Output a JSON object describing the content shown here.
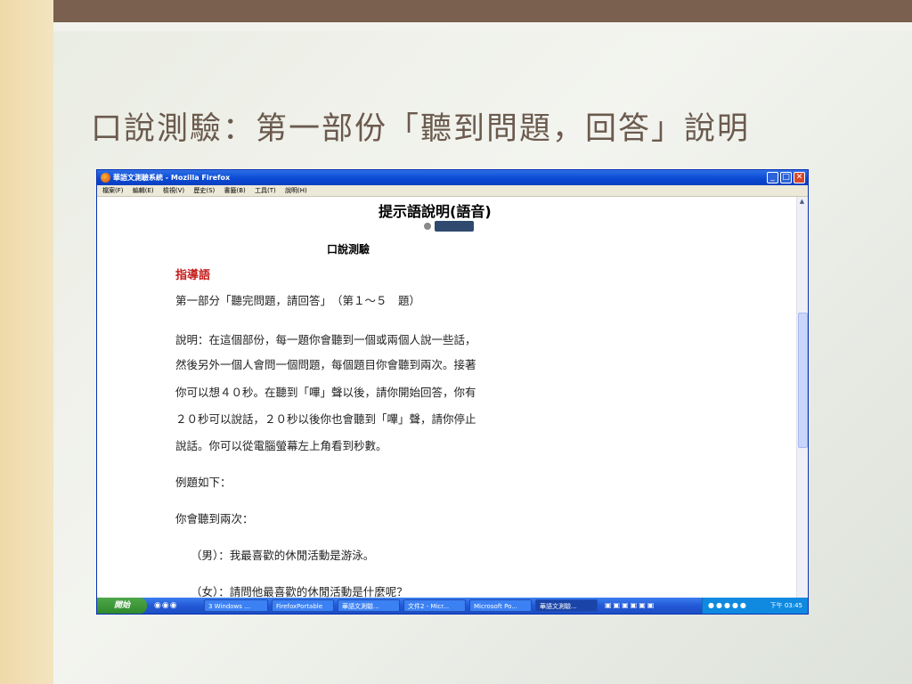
{
  "slide": {
    "title": "口說測驗：第一部份「聽到問題，回答」說明"
  },
  "window": {
    "title": "華語文測驗系統 - Mozilla Firefox",
    "menu": [
      "檔案(F)",
      "編輯(E)",
      "檢視(V)",
      "歷史(S)",
      "書籤(B)",
      "工具(T)",
      "說明(H)"
    ],
    "buttons": {
      "minimize": "_",
      "maximize": "□",
      "close": "✕"
    }
  },
  "content": {
    "heading": "提示語說明(語音)",
    "subheading": "口說測驗",
    "guide_label": "指導語",
    "part_line": "第一部分「聽完問題，請回答」　（第１～５　題）",
    "description": [
      "說明：在這個部份，每一題你會聽到一個或兩個人說一些話，",
      "然後另外一個人會問一個問題，每個題目你會聽到兩次。接著",
      "你可以想４０秒。在聽到「嗶」聲以後，請你開始回答，你有",
      "２０秒可以說話，２０秒以後你也會聽到「嗶」聲，請你停止",
      "說話。你可以從電腦螢幕左上角看到秒數。"
    ],
    "example_label": "例題如下：",
    "hear_twice": "你會聽到兩次：",
    "male_line": "（男）：我最喜歡的休閒活動是游泳。",
    "female_line": "（女）：請問他最喜歡的休閒活動是什麼呢？"
  },
  "taskbar": {
    "start": "開始",
    "items": [
      {
        "label": "3 Windows ..."
      },
      {
        "label": "FirefoxPortable"
      },
      {
        "label": "華語文測驗..."
      },
      {
        "label": "文件2 - Micr..."
      },
      {
        "label": "Microsoft Po..."
      },
      {
        "label": "華語文測驗..."
      }
    ],
    "clock": "下午 03:45"
  }
}
